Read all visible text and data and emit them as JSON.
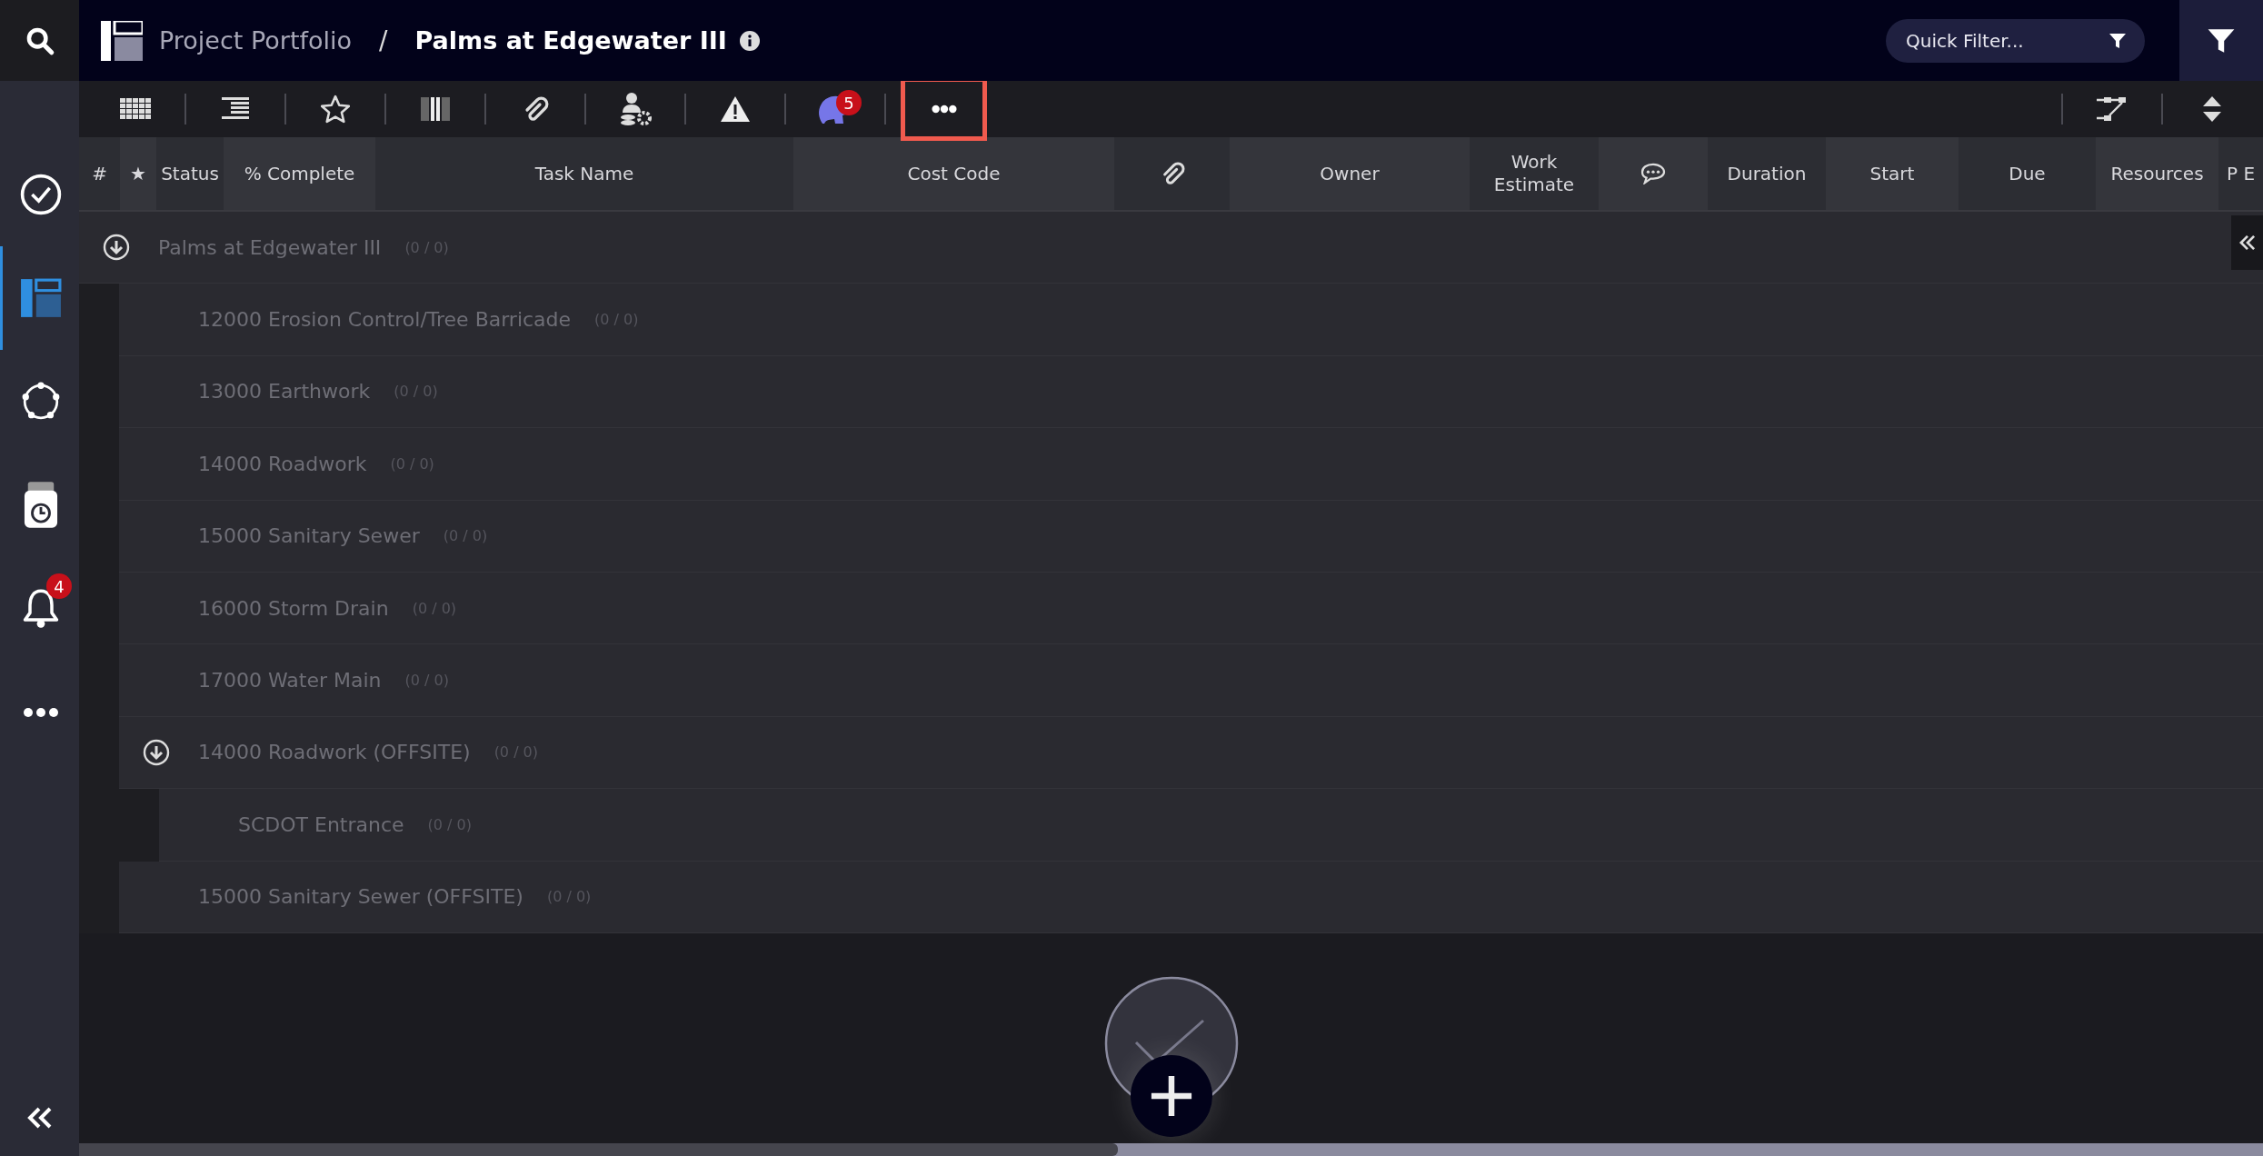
{
  "top_bar": {
    "breadcrumb": [
      {
        "label": "Project Portfolio",
        "current": false
      },
      {
        "label": "Palms at Edgewater III",
        "current": true
      }
    ],
    "separator": "/",
    "quick_filter": {
      "placeholder": "Quick Filter..."
    }
  },
  "sidebar": {
    "items": [
      {
        "kind": "check",
        "selected": false
      },
      {
        "kind": "portfolio",
        "selected": true
      },
      {
        "kind": "network",
        "selected": false
      },
      {
        "kind": "timer",
        "selected": false
      },
      {
        "kind": "bell",
        "selected": false,
        "badge": "4"
      },
      {
        "kind": "more",
        "selected": false
      }
    ]
  },
  "toolbar": {
    "items": [
      {
        "kind": "grid",
        "highlighted": false
      },
      {
        "kind": "indent",
        "highlighted": false
      },
      {
        "kind": "star",
        "highlighted": false
      },
      {
        "kind": "columns",
        "highlighted": false
      },
      {
        "kind": "paperclip",
        "highlighted": false
      },
      {
        "kind": "resources",
        "highlighted": false
      },
      {
        "kind": "warning",
        "highlighted": false
      },
      {
        "kind": "head",
        "highlighted": false,
        "badge": "5"
      },
      {
        "kind": "more",
        "highlighted": true
      }
    ],
    "right_items": [
      {
        "kind": "dependency"
      },
      {
        "kind": "sort"
      }
    ]
  },
  "table": {
    "columns": [
      {
        "kind": "text",
        "label": "#"
      },
      {
        "kind": "text",
        "label": "★"
      },
      {
        "kind": "text",
        "label": "Status"
      },
      {
        "kind": "text",
        "label": "% Complete"
      },
      {
        "kind": "text",
        "label": "Task Name"
      },
      {
        "kind": "text",
        "label": "Cost Code"
      },
      {
        "kind": "paperclip"
      },
      {
        "kind": "text",
        "label": "Owner"
      },
      {
        "kind": "text",
        "label": "Work Estimate"
      },
      {
        "kind": "comment"
      },
      {
        "kind": "text",
        "label": "Duration"
      },
      {
        "kind": "text",
        "label": "Start"
      },
      {
        "kind": "text",
        "label": "Due"
      },
      {
        "kind": "text",
        "label": "Resources"
      },
      {
        "kind": "text",
        "label": "P E"
      }
    ],
    "rows": [
      {
        "name": "Palms at Edgewater III",
        "count": "(0 / 0)",
        "expanded": true,
        "children": [
          {
            "name": "12000 Erosion Control/Tree Barricade",
            "count": "(0 / 0)"
          },
          {
            "name": "13000 Earthwork",
            "count": "(0 / 0)"
          },
          {
            "name": "14000 Roadwork",
            "count": "(0 / 0)"
          },
          {
            "name": "15000 Sanitary Sewer",
            "count": "(0 / 0)"
          },
          {
            "name": "16000 Storm Drain",
            "count": "(0 / 0)"
          },
          {
            "name": "17000 Water Main",
            "count": "(0 / 0)"
          },
          {
            "name": "14000 Roadwork (OFFSITE)",
            "count": "(0 / 0)",
            "expanded": true,
            "children": [
              {
                "name": "SCDOT Entrance",
                "count": "(0 / 0)"
              }
            ]
          },
          {
            "name": "15000 Sanitary Sewer (OFFSITE)",
            "count": "(0 / 0)"
          }
        ]
      }
    ]
  }
}
